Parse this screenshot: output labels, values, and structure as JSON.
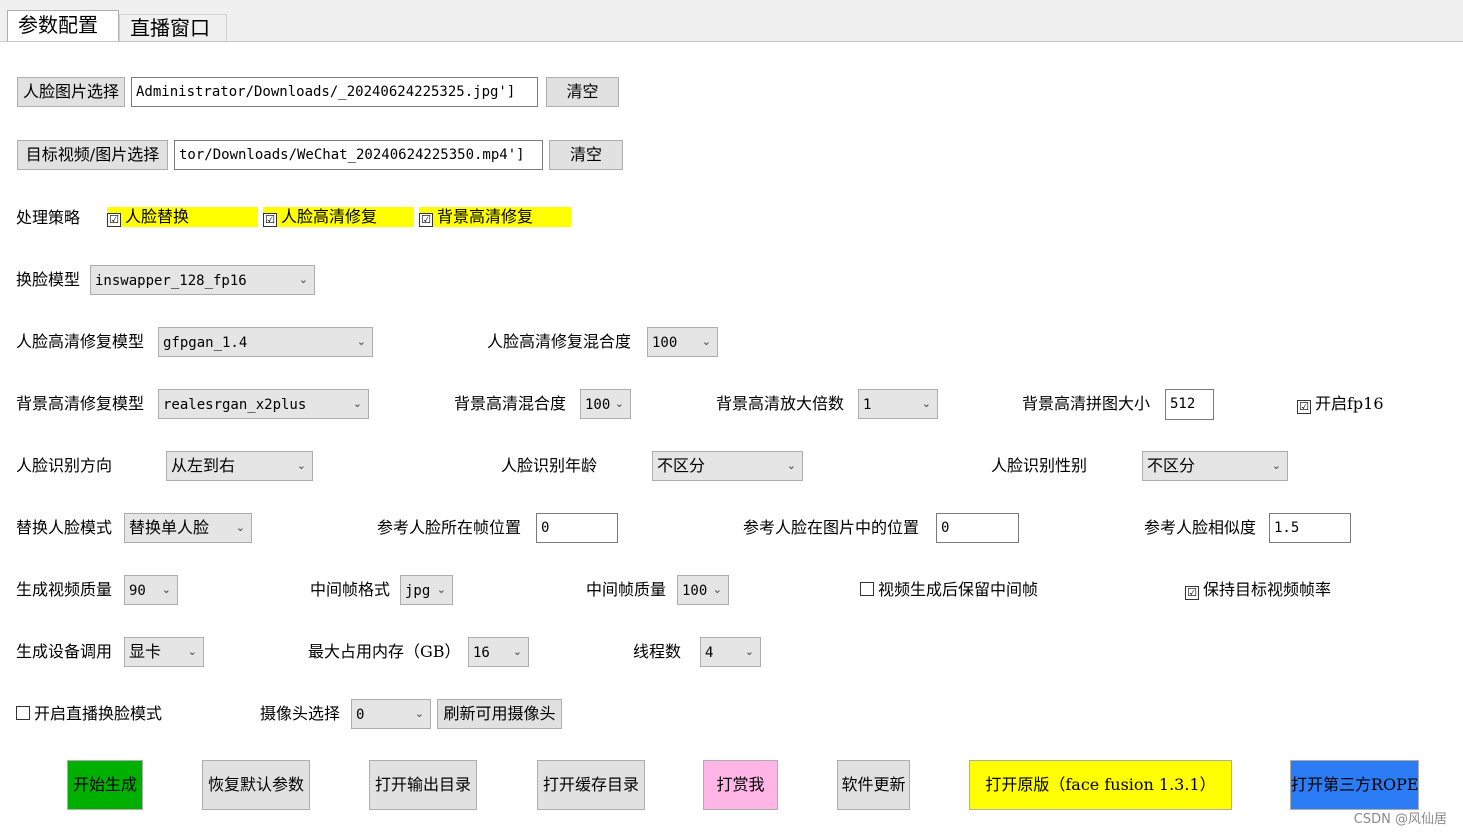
{
  "tabs": [
    {
      "label": "参数配置"
    },
    {
      "label": "直播窗口"
    }
  ],
  "face_image": {
    "button": "人脸图片选择",
    "value": "Administrator/Downloads/_20240624225325.jpg']",
    "clear": "清空"
  },
  "target_video": {
    "button": "目标视频/图片选择",
    "value": "tor/Downloads/WeChat_20240624225350.mp4']",
    "clear": "清空"
  },
  "strategy": {
    "label": "处理策略",
    "options": [
      {
        "label": "人脸替换",
        "checked": true,
        "mark": "☑"
      },
      {
        "label": "人脸高清修复",
        "checked": true,
        "mark": "☑"
      },
      {
        "label": "背景高清修复",
        "checked": true,
        "mark": "☑"
      }
    ]
  },
  "swap_model": {
    "label": "换脸模型",
    "value": "inswapper_128_fp16"
  },
  "face_enhance_model": {
    "label": "人脸高清修复模型",
    "value": "gfpgan_1.4"
  },
  "face_enhance_blend": {
    "label": "人脸高清修复混合度",
    "value": "100"
  },
  "bg_enhance_model": {
    "label": "背景高清修复模型",
    "value": "realesrgan_x2plus"
  },
  "bg_blend": {
    "label": "背景高清混合度",
    "value": "100"
  },
  "bg_scale": {
    "label": "背景高清放大倍数",
    "value": "1"
  },
  "bg_tile": {
    "label": "背景高清拼图大小",
    "value": "512"
  },
  "fp16": {
    "label": "开启fp16",
    "checked": true,
    "mark": "☑"
  },
  "face_direction": {
    "label": "人脸识别方向",
    "value": "从左到右"
  },
  "face_age": {
    "label": "人脸识别年龄",
    "value": "不区分"
  },
  "face_gender": {
    "label": "人脸识别性别",
    "value": "不区分"
  },
  "replace_mode": {
    "label": "替换人脸模式",
    "value": "替换单人脸"
  },
  "ref_frame_pos": {
    "label": "参考人脸所在帧位置",
    "value": "0"
  },
  "ref_img_pos": {
    "label": "参考人脸在图片中的位置",
    "value": "0"
  },
  "ref_similarity": {
    "label": "参考人脸相似度",
    "value": "1.5"
  },
  "video_quality": {
    "label": "生成视频质量",
    "value": "90"
  },
  "frame_format": {
    "label": "中间帧格式",
    "value": "jpg"
  },
  "frame_quality": {
    "label": "中间帧质量",
    "value": "100"
  },
  "keep_frames": {
    "label": "视频生成后保留中间帧",
    "checked": false,
    "mark": ""
  },
  "keep_fps": {
    "label": "保持目标视频帧率",
    "checked": true,
    "mark": "☑"
  },
  "device": {
    "label": "生成设备调用",
    "value": "显卡"
  },
  "max_memory": {
    "label": "最大占用内存（GB）",
    "value": "16"
  },
  "threads": {
    "label": "线程数",
    "value": "4"
  },
  "live_mode": {
    "label": "开启直播换脸模式",
    "checked": false,
    "mark": ""
  },
  "camera": {
    "label": "摄像头选择",
    "value": "0",
    "refresh": "刷新可用摄像头"
  },
  "actions": {
    "start": "开始生成",
    "reset": "恢复默认参数",
    "open_output": "打开输出目录",
    "open_cache": "打开缓存目录",
    "donate": "打赏我",
    "update": "软件更新",
    "open_original": "打开原版（face fusion 1.3.1）",
    "open_rope": "打开第三方ROPE"
  },
  "colors": {
    "start": "#00b000",
    "donate": "#ffb6e6",
    "original": "#ffff00",
    "rope": "#2b7cf5"
  },
  "watermark": "CSDN @风仙居"
}
